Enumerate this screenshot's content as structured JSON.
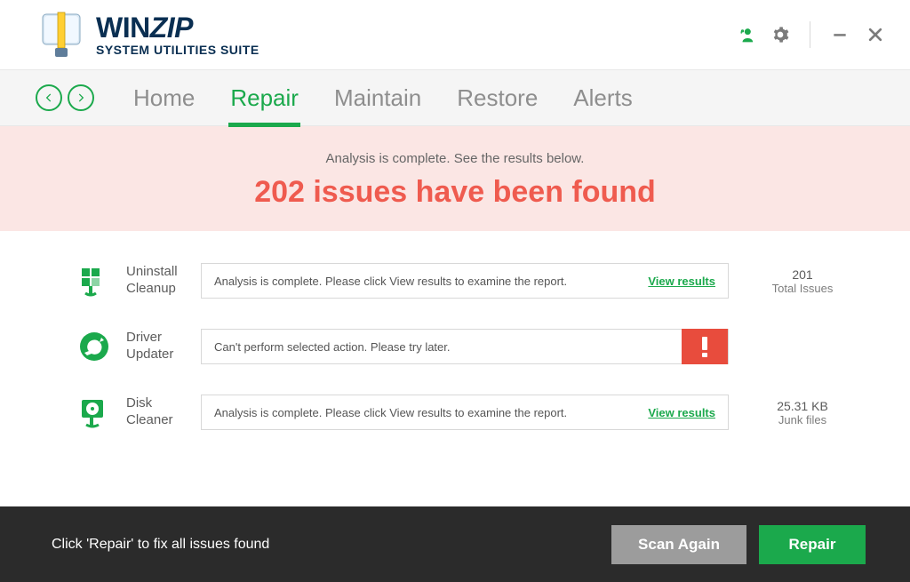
{
  "brand": {
    "name": "WINZIP",
    "sub": "SYSTEM UTILITIES SUITE"
  },
  "nav": {
    "tabs": [
      "Home",
      "Repair",
      "Maintain",
      "Restore",
      "Alerts"
    ],
    "active": 1
  },
  "banner": {
    "sub": "Analysis is complete. See the results below.",
    "title": "202 issues have been found"
  },
  "rows": [
    {
      "label": "Uninstall Cleanup",
      "msg": "Analysis is complete. Please click View results to examine the report.",
      "link": "View results",
      "meta1": "201",
      "meta2": "Total Issues"
    },
    {
      "label": "Driver Updater",
      "msg": "Can't perform selected action. Please try later.",
      "alert": true
    },
    {
      "label": "Disk Cleaner",
      "msg": "Analysis is complete. Please click View results to examine the report.",
      "link": "View results",
      "meta1": "25.31 KB",
      "meta2": "Junk files"
    }
  ],
  "footer": {
    "hint": "Click 'Repair' to fix all issues found",
    "scan": "Scan Again",
    "repair": "Repair"
  }
}
